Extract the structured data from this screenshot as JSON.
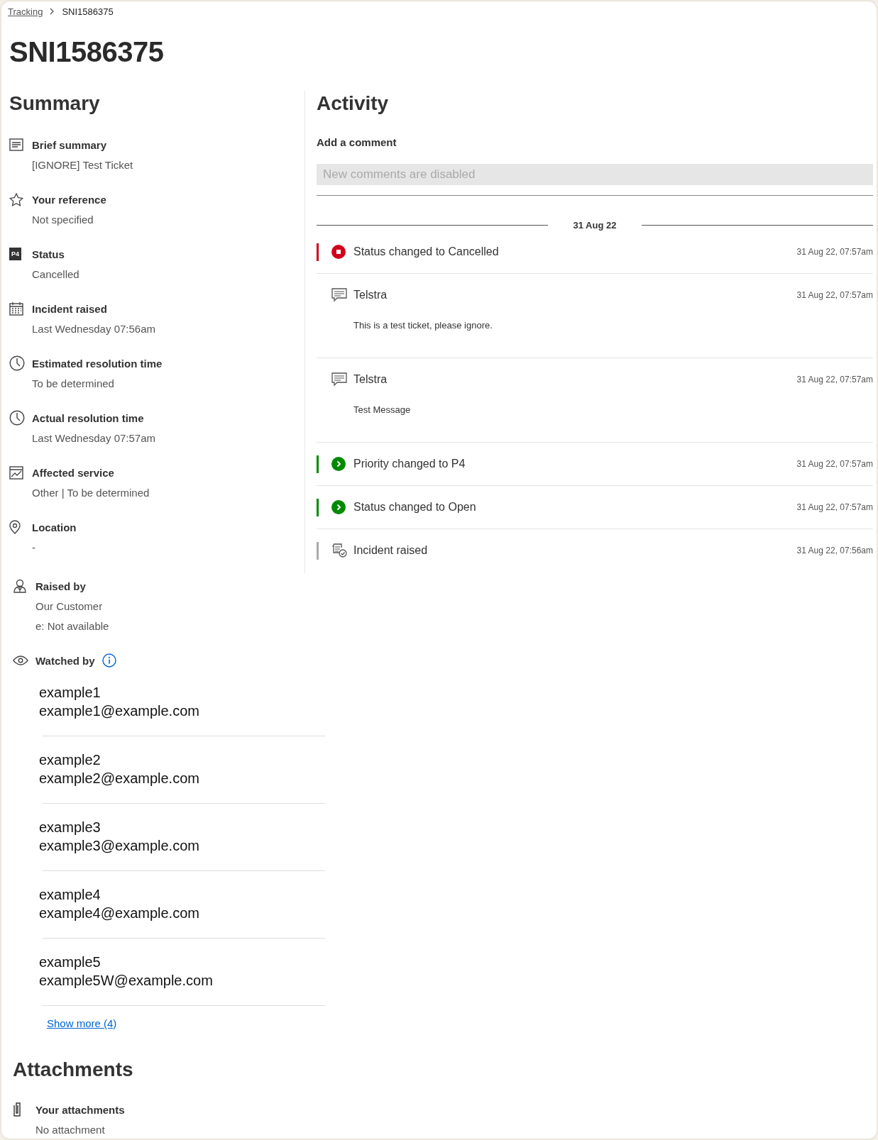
{
  "breadcrumb": {
    "link": "Tracking",
    "current": "SNI1586375"
  },
  "title": "SNI1586375",
  "summary": {
    "heading": "Summary",
    "fields": [
      {
        "kind": "lines",
        "label": "Brief summary",
        "values": [
          "[IGNORE] Test Ticket"
        ]
      },
      {
        "kind": "star",
        "label": "Your reference",
        "values": [
          "Not specified"
        ]
      },
      {
        "kind": "badge",
        "badge": "P4",
        "label": "Status",
        "values": [
          "Cancelled"
        ]
      },
      {
        "kind": "calendar",
        "label": "Incident raised",
        "values": [
          "Last Wednesday 07:56am"
        ]
      },
      {
        "kind": "clock",
        "label": "Estimated resolution time",
        "values": [
          "To be determined"
        ]
      },
      {
        "kind": "clock",
        "label": "Actual resolution time",
        "values": [
          "Last Wednesday 07:57am"
        ]
      },
      {
        "kind": "chart",
        "label": "Affected service",
        "values": [
          "Other | To be determined"
        ]
      },
      {
        "kind": "pin",
        "label": "Location",
        "values": [
          "-"
        ]
      }
    ]
  },
  "raised_by": {
    "label": "Raised by",
    "values": [
      "Our Customer",
      "e: Not available"
    ]
  },
  "watched_by": {
    "label": "Watched by",
    "watchers": [
      {
        "name": "example1",
        "email": "example1@example.com"
      },
      {
        "name": "example2",
        "email": "example2@example.com"
      },
      {
        "name": "example3",
        "email": "example3@example.com"
      },
      {
        "name": "example4",
        "email": "example4@example.com"
      },
      {
        "name": "example5",
        "email": "example5W@example.com"
      }
    ],
    "show_more": "Show more (4)"
  },
  "attachments": {
    "heading": "Attachments",
    "label": "Your attachments",
    "value": "No attachment"
  },
  "activity": {
    "heading": "Activity",
    "comment_label": "Add a comment",
    "comment_field": {
      "placeholder": "New comments are disabled",
      "disabled": true
    },
    "date": "31 Aug 22",
    "entries": [
      {
        "kind": "stop",
        "color": "#d0021b",
        "text": "Status changed to Cancelled",
        "time": "31 Aug 22, 07:57am"
      },
      {
        "kind": "comment",
        "text": "Telstra",
        "body": "This is a test ticket, please ignore.",
        "time": "31 Aug 22, 07:57am"
      },
      {
        "kind": "comment",
        "text": "Telstra",
        "body": "Test Message",
        "time": "31 Aug 22, 07:57am"
      },
      {
        "kind": "progress",
        "color": "#008a00",
        "text": "Priority changed to P4",
        "time": "31 Aug 22, 07:57am"
      },
      {
        "kind": "progress",
        "color": "#008a00",
        "text": "Status changed to Open",
        "time": "31 Aug 22, 07:57am"
      },
      {
        "kind": "raised",
        "color": "#aaaaaa",
        "text": "Incident raised",
        "time": "31 Aug 22, 07:56am"
      }
    ]
  }
}
